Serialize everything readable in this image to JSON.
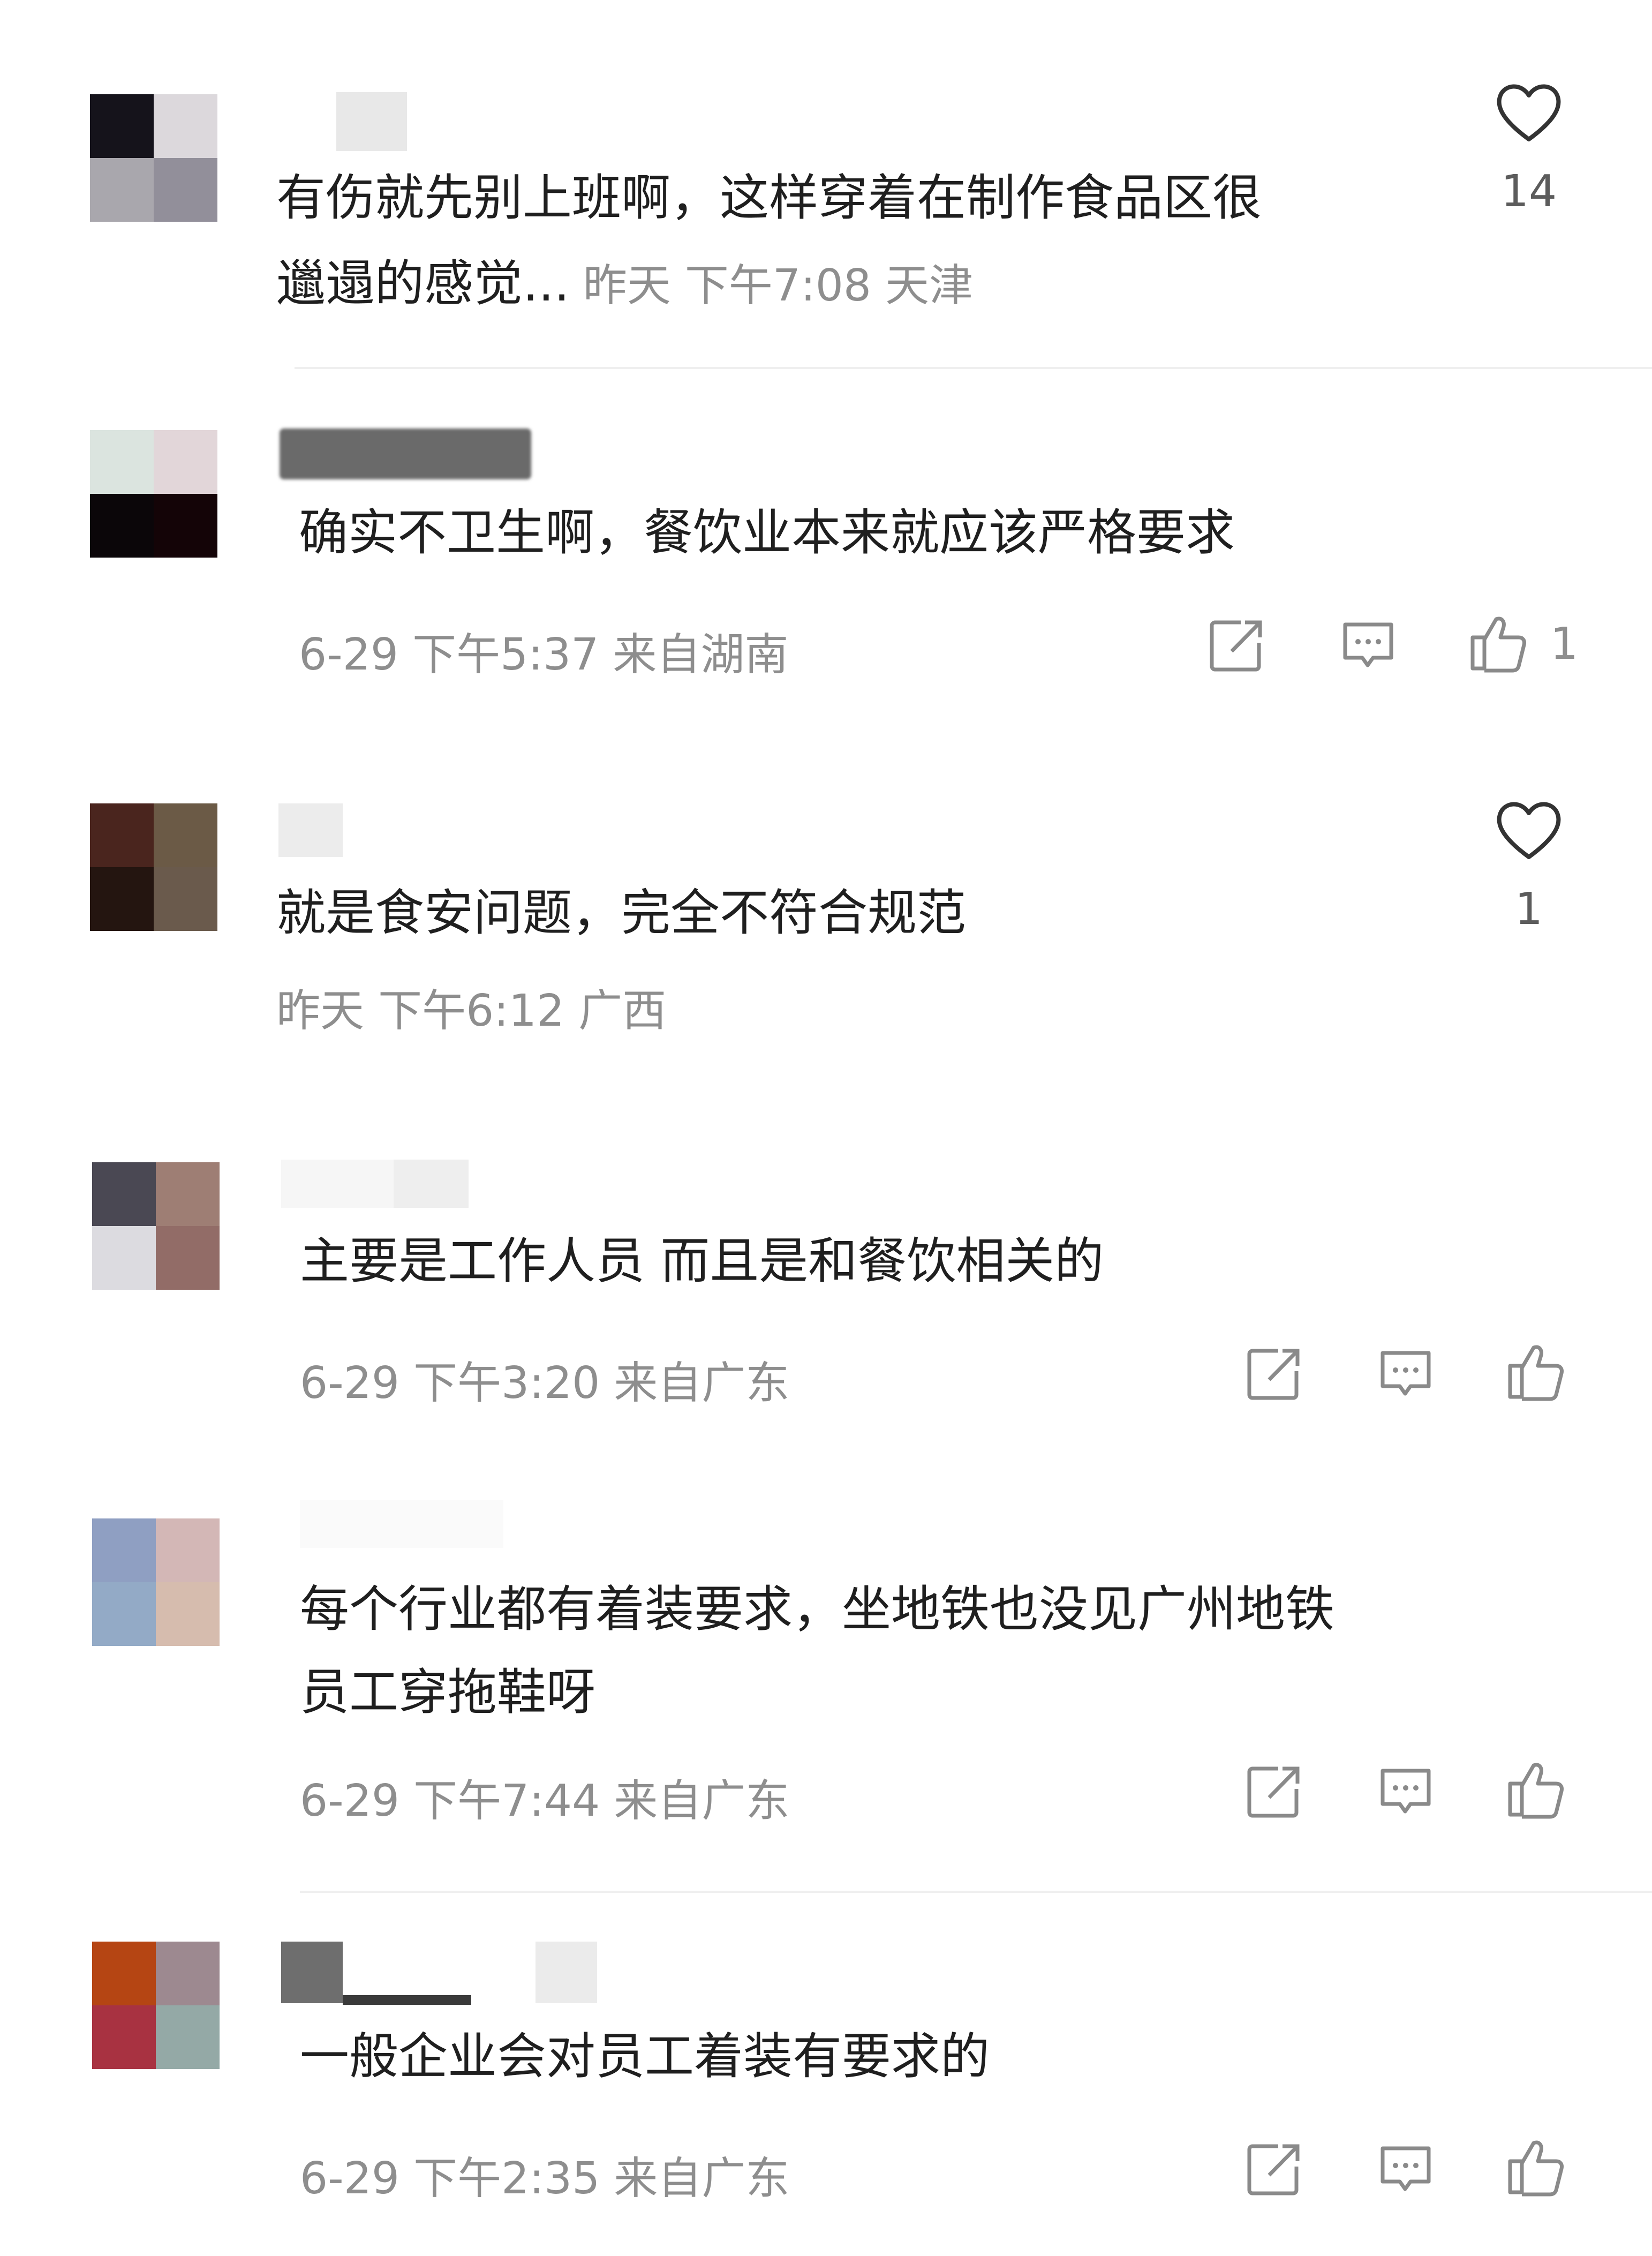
{
  "comments": [
    {
      "text_line1": "有伤就先别上班啊，这样穿着在制作食品区很",
      "text_line2": "邋遢的感觉...",
      "meta": "昨天 下午7:08 天津",
      "likes": "14",
      "avatar_colors": [
        "#15131b",
        "#dcd8dc",
        "#a9a7ad",
        "#928f9a"
      ]
    },
    {
      "text": "确实不卫生啊，餐饮业本来就应该严格要求",
      "meta": "6-29 下午5:37 来自湖南",
      "likes": "1",
      "avatar_colors": [
        "#dbe4df",
        "#e2d6d9",
        "#0b0609",
        "#140407"
      ]
    },
    {
      "text": "就是食安问题，完全不符合规范",
      "meta": "昨天 下午6:12 广西",
      "likes": "1",
      "avatar_colors": [
        "#4a251e",
        "#6b5a46",
        "#241510",
        "#6a5a4c"
      ]
    },
    {
      "text": "主要是工作人员 而且是和餐饮相关的",
      "meta": "6-29 下午3:20 来自广东",
      "avatar_colors": [
        "#4a4853",
        "#9e7e74",
        "#dcdbe0",
        "#926c67"
      ]
    },
    {
      "text_line1": "每个行业都有着装要求，坐地铁也没见广州地铁",
      "text_line2": "员工穿拖鞋呀",
      "meta": "6-29 下午7:44 来自广东",
      "avatar_colors": [
        "#8f9fc2",
        "#d3b7b6",
        "#93aac6",
        "#d6bcae"
      ]
    },
    {
      "text": "一般企业会对员工着装有要求的",
      "meta": "6-29 下午2:35 来自广东",
      "avatar_colors": [
        "#b54513",
        "#9d8990",
        "#a83241",
        "#94a9a6"
      ]
    }
  ],
  "colors": {
    "text": "#1f1f1f",
    "meta": "#8e8e8e",
    "icon": "#8a8a8a",
    "divider": "#efefef"
  },
  "icons": [
    "heart-icon",
    "share-icon",
    "comment-icon",
    "thumbs-up-icon"
  ]
}
